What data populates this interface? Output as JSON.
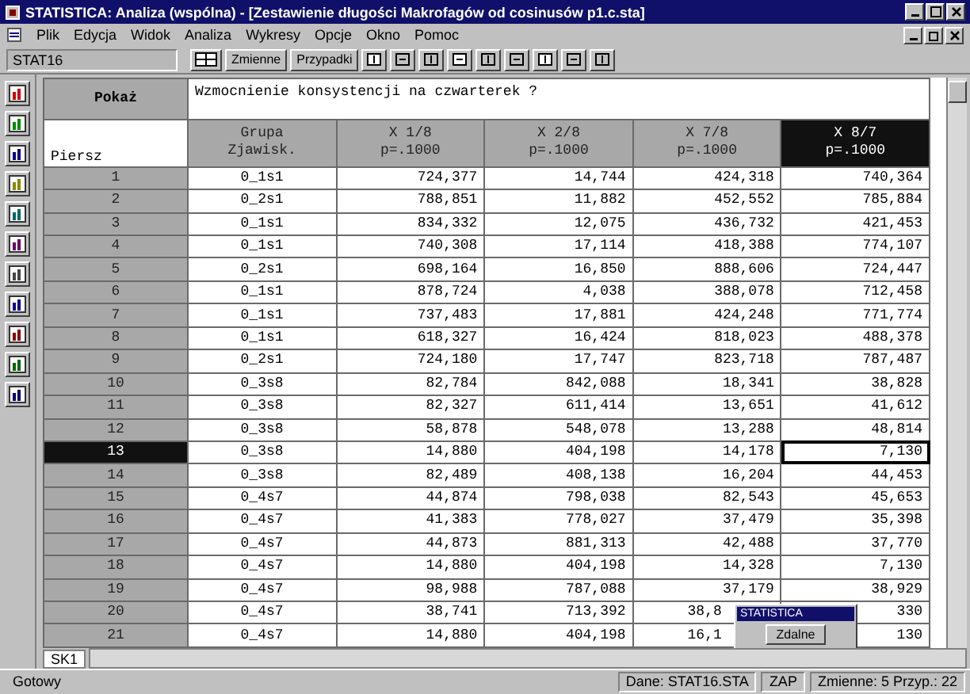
{
  "window": {
    "title": "STATISTICA: Analiza (wspólna) - [Zestawienie długości Makrofagów od cosinusów p1.c.sta]"
  },
  "menu": [
    "Plik",
    "Edycja",
    "Widok",
    "Analiza",
    "Wykresy",
    "Opcje",
    "Okno",
    "Pomoc"
  ],
  "toolbar": {
    "cell_ref": "STAT16",
    "buttons": [
      {
        "label": "Zmienne"
      },
      {
        "label": "Przypadki"
      }
    ]
  },
  "sheet": {
    "corner_label": "Pokaż",
    "description": "Wzmocnienie konsystencji na czwarterek ?",
    "row_header_label": "Piersz",
    "columns": [
      {
        "label": "Grupa\nZjawisk.",
        "selected": false
      },
      {
        "label": "X 1/8\np=.1000",
        "selected": false
      },
      {
        "label": "X 2/8\np=.1000",
        "selected": false
      },
      {
        "label": "X 7/8\np=.1000",
        "selected": false
      },
      {
        "label": "X 8/7\np=.1000",
        "selected": true
      }
    ],
    "rows": [
      {
        "label": "1",
        "selected": false,
        "cells": [
          "0_1s1",
          "724,377",
          "14,744",
          "424,318",
          "740,364"
        ]
      },
      {
        "label": "2",
        "selected": false,
        "cells": [
          "0_2s1",
          "788,851",
          "11,882",
          "452,552",
          "785,884"
        ]
      },
      {
        "label": "3",
        "selected": false,
        "cells": [
          "0_1s1",
          "834,332",
          "12,075",
          "436,732",
          "421,453"
        ]
      },
      {
        "label": "4",
        "selected": false,
        "cells": [
          "0_1s1",
          "740,308",
          "17,114",
          "418,388",
          "774,107"
        ]
      },
      {
        "label": "5",
        "selected": false,
        "cells": [
          "0_2s1",
          "698,164",
          "16,850",
          "888,606",
          "724,447"
        ]
      },
      {
        "label": "6",
        "selected": false,
        "cells": [
          "0_1s1",
          "878,724",
          "4,038",
          "388,078",
          "712,458"
        ]
      },
      {
        "label": "7",
        "selected": false,
        "cells": [
          "0_1s1",
          "737,483",
          "17,881",
          "424,248",
          "771,774"
        ]
      },
      {
        "label": "8",
        "selected": false,
        "cells": [
          "0_1s1",
          "618,327",
          "16,424",
          "818,023",
          "488,378"
        ]
      },
      {
        "label": "9",
        "selected": false,
        "cells": [
          "0_2s1",
          "724,180",
          "17,747",
          "823,718",
          "787,487"
        ]
      },
      {
        "label": "10",
        "selected": false,
        "cells": [
          "0_3s8",
          "82,784",
          "842,088",
          "18,341",
          "38,828"
        ]
      },
      {
        "label": "11",
        "selected": false,
        "cells": [
          "0_3s8",
          "82,327",
          "611,414",
          "13,651",
          "41,612"
        ]
      },
      {
        "label": "12",
        "selected": false,
        "cells": [
          "0_3s8",
          "58,878",
          "548,078",
          "13,288",
          "48,814"
        ]
      },
      {
        "label": "13",
        "selected": true,
        "cells": [
          "0_3s8",
          "14,880",
          "404,198",
          "14,178",
          "7,130"
        ]
      },
      {
        "label": "14",
        "selected": false,
        "cells": [
          "0_3s8",
          "82,489",
          "408,138",
          "16,204",
          "44,453"
        ]
      },
      {
        "label": "15",
        "selected": false,
        "cells": [
          "0_4s7",
          "44,874",
          "798,038",
          "82,543",
          "45,653"
        ]
      },
      {
        "label": "16",
        "selected": false,
        "cells": [
          "0_4s7",
          "41,383",
          "778,027",
          "37,479",
          "35,398"
        ]
      },
      {
        "label": "17",
        "selected": false,
        "cells": [
          "0_4s7",
          "44,873",
          "881,313",
          "42,488",
          "37,770"
        ]
      },
      {
        "label": "18",
        "selected": false,
        "cells": [
          "0_4s7",
          "14,880",
          "404,198",
          "14,328",
          "7,130"
        ]
      },
      {
        "label": "19",
        "selected": false,
        "cells": [
          "0_4s7",
          "98,988",
          "787,088",
          "37,179",
          "38,929"
        ]
      },
      {
        "label": "20",
        "selected": false,
        "covered": true,
        "cells": [
          "0_4s7",
          "38,741",
          "713,392",
          "38,8",
          "330"
        ]
      },
      {
        "label": "21",
        "selected": false,
        "covered": true,
        "cells": [
          "0_4s7",
          "14,880",
          "404,198",
          "16,1",
          "130"
        ]
      }
    ],
    "sheet_tab": "SK1"
  },
  "popup": {
    "title": "STATISTICA",
    "button": "Zdalne"
  },
  "status_bar": [
    "Gotowy",
    "Dane: STAT16.STA",
    "ZAP",
    "Zmienne: 5 Przyp.: 22"
  ]
}
